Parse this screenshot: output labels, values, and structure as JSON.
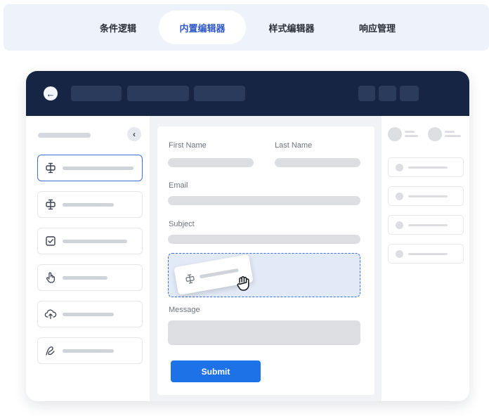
{
  "tabs": [
    {
      "label": "条件逻辑",
      "active": false
    },
    {
      "label": "内置编辑器",
      "active": true
    },
    {
      "label": "样式编辑器",
      "active": false
    },
    {
      "label": "响应管理",
      "active": false
    }
  ],
  "app": {
    "back_icon": "arrow-left-icon",
    "palette": {
      "collapse_icon": "chevron-left-icon",
      "items": [
        {
          "icon": "text-cursor-icon",
          "selected": true
        },
        {
          "icon": "text-cursor-icon",
          "selected": false
        },
        {
          "icon": "checkbox-icon",
          "selected": false
        },
        {
          "icon": "pointer-hand-icon",
          "selected": false
        },
        {
          "icon": "upload-cloud-icon",
          "selected": false
        },
        {
          "icon": "signature-icon",
          "selected": false
        }
      ]
    },
    "form": {
      "first_name_label": "First Name",
      "last_name_label": "Last Name",
      "email_label": "Email",
      "subject_label": "Subject",
      "message_label": "Message",
      "submit_label": "Submit",
      "dragged_field_icon": "text-cursor-icon",
      "cursor_icon": "grab-hand-icon"
    }
  },
  "colors": {
    "accent": "#2f59c9",
    "topbar": "#162543",
    "submit": "#1e72e8",
    "dropzone_border": "#3d6fe0",
    "dropzone_fill": "#e3eaf7"
  }
}
